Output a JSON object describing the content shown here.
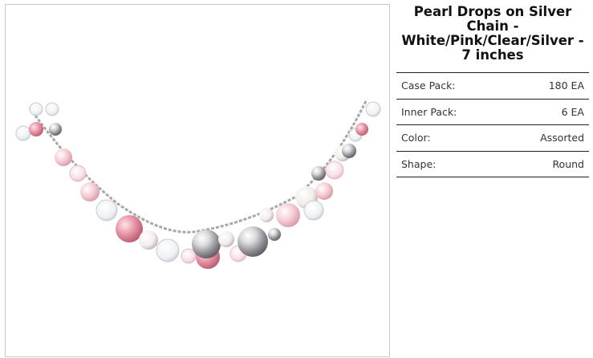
{
  "product": {
    "title": "Pearl Drops on Silver Chain - White/Pink/Clear/Silver - 7 inches",
    "image_alt": "necklace-photo"
  },
  "specs": [
    {
      "label": "Case Pack:",
      "value": "180 EA"
    },
    {
      "label": "Inner Pack:",
      "value": "6 EA"
    },
    {
      "label": "Color:",
      "value": "Assorted"
    },
    {
      "label": "Shape:",
      "value": "Round"
    }
  ],
  "colors": {
    "pink": "#e58fa2",
    "light_pink": "#f4c7cf",
    "white_pearl": "#f1ecea",
    "silver": "#b9b9bd",
    "chain": "#a8a8ac"
  }
}
